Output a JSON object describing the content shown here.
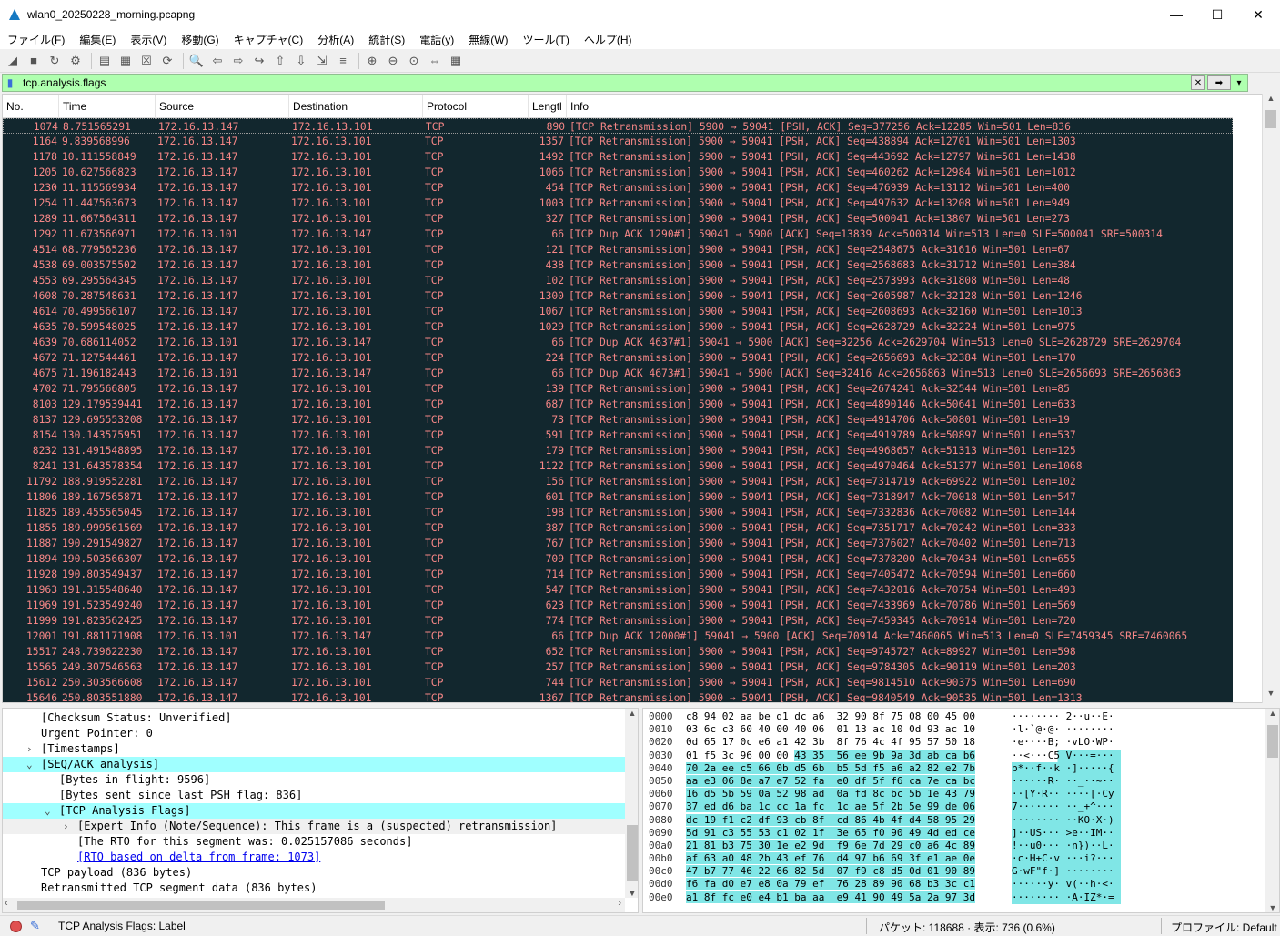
{
  "window": {
    "title": "wlan0_20250228_morning.pcapng",
    "minimize": "—",
    "maximize": "☐",
    "close": "✕"
  },
  "menu": [
    "ファイル(F)",
    "編集(E)",
    "表示(V)",
    "移動(G)",
    "キャプチャ(C)",
    "分析(A)",
    "統計(S)",
    "電話(y)",
    "無線(W)",
    "ツール(T)",
    "ヘルプ(H)"
  ],
  "toolbar_icons": [
    "shark-fin-start-icon",
    "stop-icon",
    "restart-icon",
    "capture-options-icon",
    "open-icon",
    "save-icon",
    "close-file-icon",
    "reload-icon",
    "find-icon",
    "back-icon",
    "forward-icon",
    "goto-icon",
    "first-icon",
    "last-icon",
    "autoscroll-icon",
    "colorize-icon",
    "zoom-in-icon",
    "zoom-out-icon",
    "zoom-normal-icon",
    "resize-columns-icon",
    "layout-icon"
  ],
  "filter": {
    "value": "tcp.analysis.flags",
    "clear": "✕",
    "apply": "➡",
    "dropdown": "▾",
    "add": "+"
  },
  "columns": [
    "No.",
    "Time",
    "Source",
    "Destination",
    "Protocol",
    "Lengtl",
    "Info"
  ],
  "packets": [
    [
      "1074",
      "8.751565291",
      "172.16.13.147",
      "172.16.13.101",
      "TCP",
      "890",
      "[TCP Retransmission] 5900 → 59041 [PSH, ACK] Seq=377256 Ack=12285 Win=501 Len=836"
    ],
    [
      "1164",
      "9.839568996",
      "172.16.13.147",
      "172.16.13.101",
      "TCP",
      "1357",
      "[TCP Retransmission] 5900 → 59041 [PSH, ACK] Seq=438894 Ack=12701 Win=501 Len=1303"
    ],
    [
      "1178",
      "10.111558849",
      "172.16.13.147",
      "172.16.13.101",
      "TCP",
      "1492",
      "[TCP Retransmission] 5900 → 59041 [PSH, ACK] Seq=443692 Ack=12797 Win=501 Len=1438"
    ],
    [
      "1205",
      "10.627566823",
      "172.16.13.147",
      "172.16.13.101",
      "TCP",
      "1066",
      "[TCP Retransmission] 5900 → 59041 [PSH, ACK] Seq=460262 Ack=12984 Win=501 Len=1012"
    ],
    [
      "1230",
      "11.115569934",
      "172.16.13.147",
      "172.16.13.101",
      "TCP",
      "454",
      "[TCP Retransmission] 5900 → 59041 [PSH, ACK] Seq=476939 Ack=13112 Win=501 Len=400"
    ],
    [
      "1254",
      "11.447563673",
      "172.16.13.147",
      "172.16.13.101",
      "TCP",
      "1003",
      "[TCP Retransmission] 5900 → 59041 [PSH, ACK] Seq=497632 Ack=13208 Win=501 Len=949"
    ],
    [
      "1289",
      "11.667564311",
      "172.16.13.147",
      "172.16.13.101",
      "TCP",
      "327",
      "[TCP Retransmission] 5900 → 59041 [PSH, ACK] Seq=500041 Ack=13807 Win=501 Len=273"
    ],
    [
      "1292",
      "11.673566971",
      "172.16.13.101",
      "172.16.13.147",
      "TCP",
      "66",
      "[TCP Dup ACK 1290#1] 59041 → 5900 [ACK] Seq=13839 Ack=500314 Win=513 Len=0 SLE=500041 SRE=500314"
    ],
    [
      "4514",
      "68.779565236",
      "172.16.13.147",
      "172.16.13.101",
      "TCP",
      "121",
      "[TCP Retransmission] 5900 → 59041 [PSH, ACK] Seq=2548675 Ack=31616 Win=501 Len=67"
    ],
    [
      "4538",
      "69.003575502",
      "172.16.13.147",
      "172.16.13.101",
      "TCP",
      "438",
      "[TCP Retransmission] 5900 → 59041 [PSH, ACK] Seq=2568683 Ack=31712 Win=501 Len=384"
    ],
    [
      "4553",
      "69.295564345",
      "172.16.13.147",
      "172.16.13.101",
      "TCP",
      "102",
      "[TCP Retransmission] 5900 → 59041 [PSH, ACK] Seq=2573993 Ack=31808 Win=501 Len=48"
    ],
    [
      "4608",
      "70.287548631",
      "172.16.13.147",
      "172.16.13.101",
      "TCP",
      "1300",
      "[TCP Retransmission] 5900 → 59041 [PSH, ACK] Seq=2605987 Ack=32128 Win=501 Len=1246"
    ],
    [
      "4614",
      "70.499566107",
      "172.16.13.147",
      "172.16.13.101",
      "TCP",
      "1067",
      "[TCP Retransmission] 5900 → 59041 [PSH, ACK] Seq=2608693 Ack=32160 Win=501 Len=1013"
    ],
    [
      "4635",
      "70.599548025",
      "172.16.13.147",
      "172.16.13.101",
      "TCP",
      "1029",
      "[TCP Retransmission] 5900 → 59041 [PSH, ACK] Seq=2628729 Ack=32224 Win=501 Len=975"
    ],
    [
      "4639",
      "70.686114052",
      "172.16.13.101",
      "172.16.13.147",
      "TCP",
      "66",
      "[TCP Dup ACK 4637#1] 59041 → 5900 [ACK] Seq=32256 Ack=2629704 Win=513 Len=0 SLE=2628729 SRE=2629704"
    ],
    [
      "4672",
      "71.127544461",
      "172.16.13.147",
      "172.16.13.101",
      "TCP",
      "224",
      "[TCP Retransmission] 5900 → 59041 [PSH, ACK] Seq=2656693 Ack=32384 Win=501 Len=170"
    ],
    [
      "4675",
      "71.196182443",
      "172.16.13.101",
      "172.16.13.147",
      "TCP",
      "66",
      "[TCP Dup ACK 4673#1] 59041 → 5900 [ACK] Seq=32416 Ack=2656863 Win=513 Len=0 SLE=2656693 SRE=2656863"
    ],
    [
      "4702",
      "71.795566805",
      "172.16.13.147",
      "172.16.13.101",
      "TCP",
      "139",
      "[TCP Retransmission] 5900 → 59041 [PSH, ACK] Seq=2674241 Ack=32544 Win=501 Len=85"
    ],
    [
      "8103",
      "129.179539441",
      "172.16.13.147",
      "172.16.13.101",
      "TCP",
      "687",
      "[TCP Retransmission] 5900 → 59041 [PSH, ACK] Seq=4890146 Ack=50641 Win=501 Len=633"
    ],
    [
      "8137",
      "129.695553208",
      "172.16.13.147",
      "172.16.13.101",
      "TCP",
      "73",
      "[TCP Retransmission] 5900 → 59041 [PSH, ACK] Seq=4914706 Ack=50801 Win=501 Len=19"
    ],
    [
      "8154",
      "130.143575951",
      "172.16.13.147",
      "172.16.13.101",
      "TCP",
      "591",
      "[TCP Retransmission] 5900 → 59041 [PSH, ACK] Seq=4919789 Ack=50897 Win=501 Len=537"
    ],
    [
      "8232",
      "131.491548895",
      "172.16.13.147",
      "172.16.13.101",
      "TCP",
      "179",
      "[TCP Retransmission] 5900 → 59041 [PSH, ACK] Seq=4968657 Ack=51313 Win=501 Len=125"
    ],
    [
      "8241",
      "131.643578354",
      "172.16.13.147",
      "172.16.13.101",
      "TCP",
      "1122",
      "[TCP Retransmission] 5900 → 59041 [PSH, ACK] Seq=4970464 Ack=51377 Win=501 Len=1068"
    ],
    [
      "11792",
      "188.919552281",
      "172.16.13.147",
      "172.16.13.101",
      "TCP",
      "156",
      "[TCP Retransmission] 5900 → 59041 [PSH, ACK] Seq=7314719 Ack=69922 Win=501 Len=102"
    ],
    [
      "11806",
      "189.167565871",
      "172.16.13.147",
      "172.16.13.101",
      "TCP",
      "601",
      "[TCP Retransmission] 5900 → 59041 [PSH, ACK] Seq=7318947 Ack=70018 Win=501 Len=547"
    ],
    [
      "11825",
      "189.455565045",
      "172.16.13.147",
      "172.16.13.101",
      "TCP",
      "198",
      "[TCP Retransmission] 5900 → 59041 [PSH, ACK] Seq=7332836 Ack=70082 Win=501 Len=144"
    ],
    [
      "11855",
      "189.999561569",
      "172.16.13.147",
      "172.16.13.101",
      "TCP",
      "387",
      "[TCP Retransmission] 5900 → 59041 [PSH, ACK] Seq=7351717 Ack=70242 Win=501 Len=333"
    ],
    [
      "11887",
      "190.291549827",
      "172.16.13.147",
      "172.16.13.101",
      "TCP",
      "767",
      "[TCP Retransmission] 5900 → 59041 [PSH, ACK] Seq=7376027 Ack=70402 Win=501 Len=713"
    ],
    [
      "11894",
      "190.503566307",
      "172.16.13.147",
      "172.16.13.101",
      "TCP",
      "709",
      "[TCP Retransmission] 5900 → 59041 [PSH, ACK] Seq=7378200 Ack=70434 Win=501 Len=655"
    ],
    [
      "11928",
      "190.803549437",
      "172.16.13.147",
      "172.16.13.101",
      "TCP",
      "714",
      "[TCP Retransmission] 5900 → 59041 [PSH, ACK] Seq=7405472 Ack=70594 Win=501 Len=660"
    ],
    [
      "11963",
      "191.315548640",
      "172.16.13.147",
      "172.16.13.101",
      "TCP",
      "547",
      "[TCP Retransmission] 5900 → 59041 [PSH, ACK] Seq=7432016 Ack=70754 Win=501 Len=493"
    ],
    [
      "11969",
      "191.523549240",
      "172.16.13.147",
      "172.16.13.101",
      "TCP",
      "623",
      "[TCP Retransmission] 5900 → 59041 [PSH, ACK] Seq=7433969 Ack=70786 Win=501 Len=569"
    ],
    [
      "11999",
      "191.823562425",
      "172.16.13.147",
      "172.16.13.101",
      "TCP",
      "774",
      "[TCP Retransmission] 5900 → 59041 [PSH, ACK] Seq=7459345 Ack=70914 Win=501 Len=720"
    ],
    [
      "12001",
      "191.881171908",
      "172.16.13.101",
      "172.16.13.147",
      "TCP",
      "66",
      "[TCP Dup ACK 12000#1] 59041 → 5900 [ACK] Seq=70914 Ack=7460065 Win=513 Len=0 SLE=7459345 SRE=7460065"
    ],
    [
      "15517",
      "248.739622230",
      "172.16.13.147",
      "172.16.13.101",
      "TCP",
      "652",
      "[TCP Retransmission] 5900 → 59041 [PSH, ACK] Seq=9745727 Ack=89927 Win=501 Len=598"
    ],
    [
      "15565",
      "249.307546563",
      "172.16.13.147",
      "172.16.13.101",
      "TCP",
      "257",
      "[TCP Retransmission] 5900 → 59041 [PSH, ACK] Seq=9784305 Ack=90119 Win=501 Len=203"
    ],
    [
      "15612",
      "250.303566608",
      "172.16.13.147",
      "172.16.13.101",
      "TCP",
      "744",
      "[TCP Retransmission] 5900 → 59041 [PSH, ACK] Seq=9814510 Ack=90375 Win=501 Len=690"
    ],
    [
      "15646",
      "250.803551880",
      "172.16.13.147",
      "172.16.13.101",
      "TCP",
      "1367",
      "[TCP Retransmission] 5900 → 59041 [PSH, ACK] Seq=9840549 Ack=90535 Win=501 Len=1313"
    ]
  ],
  "details": [
    {
      "indent": 2,
      "toggle": "",
      "text": "[Checksum Status: Unverified]",
      "hl": false,
      "link": false
    },
    {
      "indent": 2,
      "toggle": "",
      "text": "Urgent Pointer: 0",
      "hl": false,
      "link": false
    },
    {
      "indent": 2,
      "toggle": "›",
      "text": "[Timestamps]",
      "hl": false,
      "link": false
    },
    {
      "indent": 2,
      "toggle": "⌄",
      "text": "[SEQ/ACK analysis]",
      "hl": true,
      "link": false
    },
    {
      "indent": 3,
      "toggle": "",
      "text": "[Bytes in flight: 9596]",
      "hl": false,
      "link": false
    },
    {
      "indent": 3,
      "toggle": "",
      "text": "[Bytes sent since last PSH flag: 836]",
      "hl": false,
      "link": false
    },
    {
      "indent": 3,
      "toggle": "⌄",
      "text": "[TCP Analysis Flags]",
      "hl": true,
      "link": false
    },
    {
      "indent": 4,
      "toggle": "›",
      "text": "[Expert Info (Note/Sequence): This frame is a (suspected) retransmission]",
      "hl": false,
      "link": false,
      "sel": true
    },
    {
      "indent": 4,
      "toggle": "",
      "text": "[The RTO for this segment was: 0.025157086 seconds]",
      "hl": false,
      "link": false
    },
    {
      "indent": 4,
      "toggle": "",
      "text": "[RTO based on delta from frame: 1073]",
      "hl": false,
      "link": true
    },
    {
      "indent": 2,
      "toggle": "",
      "text": "TCP payload (836 bytes)",
      "hl": false,
      "link": false
    },
    {
      "indent": 2,
      "toggle": "",
      "text": "Retransmitted TCP segment data (836 bytes)",
      "hl": false,
      "link": false
    }
  ],
  "hex": [
    {
      "off": "0000",
      "bytes": [
        "c8",
        "94",
        "02",
        "aa",
        "be",
        "d1",
        "dc",
        "a6",
        "32",
        "90",
        "8f",
        "75",
        "08",
        "00",
        "45",
        "00"
      ],
      "ascii": "········ 2··u··E·",
      "hfrom": 99
    },
    {
      "off": "0010",
      "bytes": [
        "03",
        "6c",
        "c3",
        "60",
        "40",
        "00",
        "40",
        "06",
        "01",
        "13",
        "ac",
        "10",
        "0d",
        "93",
        "ac",
        "10"
      ],
      "ascii": "·l·`@·@· ········",
      "hfrom": 99
    },
    {
      "off": "0020",
      "bytes": [
        "0d",
        "65",
        "17",
        "0c",
        "e6",
        "a1",
        "42",
        "3b",
        "8f",
        "76",
        "4c",
        "4f",
        "95",
        "57",
        "50",
        "18"
      ],
      "ascii": "·e····B; ·vLO·WP·",
      "hfrom": 99
    },
    {
      "off": "0030",
      "bytes": [
        "01",
        "f5",
        "3c",
        "96",
        "00",
        "00",
        "43",
        "35",
        "56",
        "ee",
        "9b",
        "9a",
        "3d",
        "ab",
        "ca",
        "b6"
      ],
      "ascii": "··<···C5 V···=···",
      "hfrom": 6
    },
    {
      "off": "0040",
      "bytes": [
        "70",
        "2a",
        "ee",
        "c5",
        "66",
        "0b",
        "d5",
        "6b",
        "b5",
        "5d",
        "f5",
        "a6",
        "a2",
        "82",
        "e2",
        "7b"
      ],
      "ascii": "p*··f··k ·]·····{",
      "hfrom": 0
    },
    {
      "off": "0050",
      "bytes": [
        "aa",
        "e3",
        "06",
        "8e",
        "a7",
        "e7",
        "52",
        "fa",
        "e0",
        "df",
        "5f",
        "f6",
        "ca",
        "7e",
        "ca",
        "bc"
      ],
      "ascii": "······R· ··_··~··",
      "hfrom": 0
    },
    {
      "off": "0060",
      "bytes": [
        "16",
        "d5",
        "5b",
        "59",
        "0a",
        "52",
        "98",
        "ad",
        "0a",
        "fd",
        "8c",
        "bc",
        "5b",
        "1e",
        "43",
        "79"
      ],
      "ascii": "··[Y·R·· ····[·Cy",
      "hfrom": 0
    },
    {
      "off": "0070",
      "bytes": [
        "37",
        "ed",
        "d6",
        "ba",
        "1c",
        "cc",
        "1a",
        "fc",
        "1c",
        "ae",
        "5f",
        "2b",
        "5e",
        "99",
        "de",
        "06"
      ],
      "ascii": "7······· ··_+^···",
      "hfrom": 0
    },
    {
      "off": "0080",
      "bytes": [
        "dc",
        "19",
        "f1",
        "c2",
        "df",
        "93",
        "cb",
        "8f",
        "cd",
        "86",
        "4b",
        "4f",
        "d4",
        "58",
        "95",
        "29"
      ],
      "ascii": "········ ··KO·X·)",
      "hfrom": 0
    },
    {
      "off": "0090",
      "bytes": [
        "5d",
        "91",
        "c3",
        "55",
        "53",
        "c1",
        "02",
        "1f",
        "3e",
        "65",
        "f0",
        "90",
        "49",
        "4d",
        "ed",
        "ce"
      ],
      "ascii": "]··US··· >e··IM··",
      "hfrom": 0
    },
    {
      "off": "00a0",
      "bytes": [
        "21",
        "81",
        "b3",
        "75",
        "30",
        "1e",
        "e2",
        "9d",
        "f9",
        "6e",
        "7d",
        "29",
        "c0",
        "a6",
        "4c",
        "89"
      ],
      "ascii": "!··u0··· ·n})··L·",
      "hfrom": 0
    },
    {
      "off": "00b0",
      "bytes": [
        "af",
        "63",
        "a0",
        "48",
        "2b",
        "43",
        "ef",
        "76",
        "d4",
        "97",
        "b6",
        "69",
        "3f",
        "e1",
        "ae",
        "0e"
      ],
      "ascii": "·c·H+C·v ···i?···",
      "hfrom": 0
    },
    {
      "off": "00c0",
      "bytes": [
        "47",
        "b7",
        "77",
        "46",
        "22",
        "66",
        "82",
        "5d",
        "07",
        "f9",
        "c8",
        "d5",
        "0d",
        "01",
        "90",
        "89"
      ],
      "ascii": "G·wF\"f·] ········",
      "hfrom": 0
    },
    {
      "off": "00d0",
      "bytes": [
        "f6",
        "fa",
        "d0",
        "e7",
        "e8",
        "0a",
        "79",
        "ef",
        "76",
        "28",
        "89",
        "90",
        "68",
        "b3",
        "3c",
        "c1"
      ],
      "ascii": "······y· v(··h·<·",
      "hfrom": 0
    },
    {
      "off": "00e0",
      "bytes": [
        "a1",
        "8f",
        "fc",
        "e0",
        "e4",
        "b1",
        "ba",
        "aa",
        "e9",
        "41",
        "90",
        "49",
        "5a",
        "2a",
        "97",
        "3d"
      ],
      "ascii": "········ ·A·IZ*·=",
      "hfrom": 0
    }
  ],
  "status": {
    "label": "TCP Analysis Flags: Label",
    "packets": "パケット: 118688 · 表示: 736 (0.6%)",
    "profile": "プロファイル: Default"
  }
}
